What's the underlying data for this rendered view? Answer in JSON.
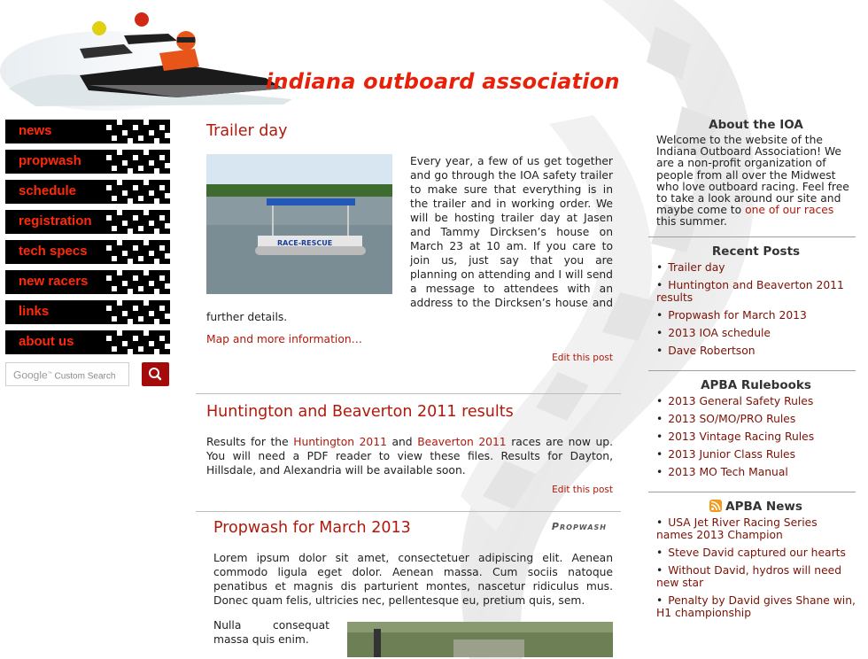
{
  "site": {
    "title": "indiana outboard association"
  },
  "nav": {
    "items": [
      {
        "label": "news"
      },
      {
        "label": "propwash"
      },
      {
        "label": "schedule"
      },
      {
        "label": "registration"
      },
      {
        "label": "tech specs"
      },
      {
        "label": "new racers"
      },
      {
        "label": "links"
      },
      {
        "label": "about us"
      }
    ]
  },
  "search": {
    "placeholder_brand": "Google",
    "placeholder_text": "Custom Search",
    "button_icon": "search-icon"
  },
  "posts": [
    {
      "title": "Trailer day",
      "body": "Every year, a few of us get together and go through the IOA safety trailer to make sure that everything is in the trailer and in working order. We will be hosting trailer day at Jasen and Tammy Dircksen’s house on March 23 at 10 am. If you care to join us, just say that you are planning on attending and I will send a message to attendees with an address to the Dircksen’s house and further details.",
      "more_link": "Map and more information…",
      "edit_link": "Edit this post",
      "photo_text": "RACE-RESCUE"
    },
    {
      "title": "Huntington and Beaverton 2011 results",
      "body_prefix": "Results for the ",
      "link1": "Huntington 2011",
      "body_mid": " and ",
      "link2": "Beaverton 2011",
      "body_suffix": " races are now up. You will need a PDF reader to view these files. Results for Dayton, Hillsdale, and Alexandria will be available soon.",
      "edit_link": "Edit this post"
    },
    {
      "title": "Propwash for March 2013",
      "category": "Propwash",
      "body": "Lorem ipsum dolor sit amet, consectetuer adipiscing elit. Aenean commodo ligula eget dolor. Aenean massa. Cum sociis natoque penatibus et magnis dis parturient montes, nascetur ridiculus mus. Donec quam felis, ultricies nec, pellentesque eu, pretium quis, sem.",
      "body2": "Nulla consequat massa quis enim."
    }
  ],
  "sidebar": {
    "about": {
      "title": "About the IOA",
      "text_prefix": "Welcome to the website of the Indiana Outboard Association! We are a non-profit organization of people from all over the Midwest who love outboard racing. Feel free to take a look around our site and maybe come to ",
      "link": "one of our races",
      "text_suffix": " this summer."
    },
    "recent": {
      "title": "Recent Posts",
      "items": [
        "Trailer day",
        "Huntington and Beaverton 2011 results",
        "Propwash for March 2013",
        "2013 IOA schedule",
        "Dave Robertson"
      ]
    },
    "rulebooks": {
      "title": "APBA Rulebooks",
      "items": [
        "2013 General Safety Rules",
        "2013 SO/MO/PRO Rules",
        "2013 Vintage Racing Rules",
        "2013 Junior Class Rules",
        "2013 MO Tech Manual"
      ]
    },
    "news": {
      "title": "APBA News",
      "icon": "rss-icon",
      "items": [
        "USA Jet River Racing Series names 2013 Champion",
        "Steve David captured our hearts",
        "Without David, hydros will need new star",
        "Penalty by David gives Shane win, H1 championship"
      ]
    }
  },
  "colors": {
    "accent_red": "#e8220a",
    "link_red": "#b0190b",
    "nav_bg": "#000000",
    "search_btn": "#a60b0b"
  }
}
